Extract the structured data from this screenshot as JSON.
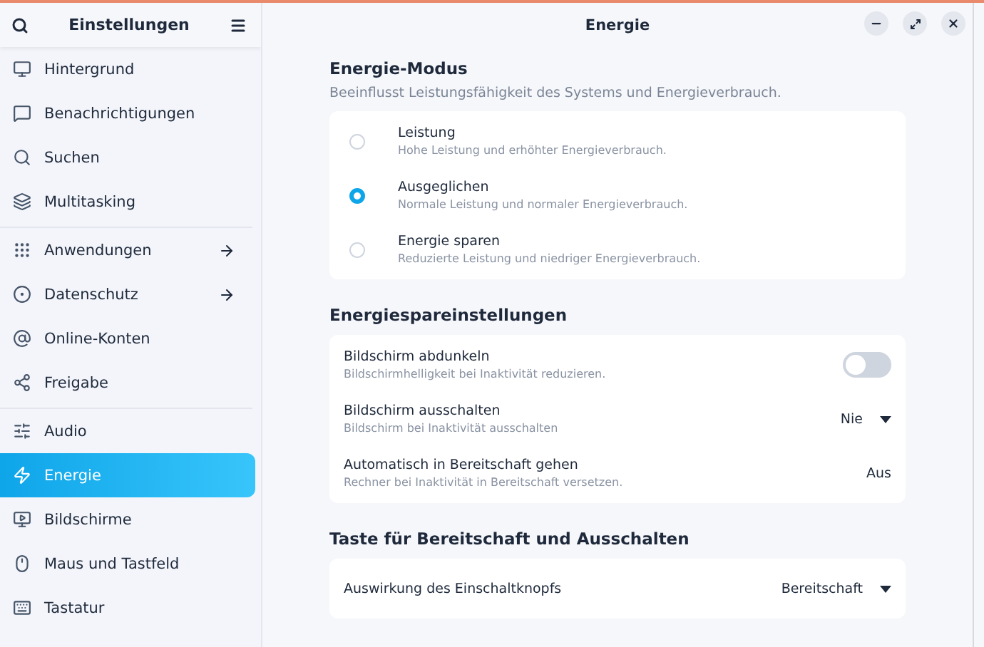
{
  "sidebar": {
    "title": "Einstellungen",
    "groups": [
      {
        "items": [
          {
            "label": "Hintergrund",
            "arrow": false,
            "selected": false
          },
          {
            "label": "Benachrichtigungen",
            "arrow": false,
            "selected": false
          },
          {
            "label": "Suchen",
            "arrow": false,
            "selected": false
          },
          {
            "label": "Multitasking",
            "arrow": false,
            "selected": false
          }
        ]
      },
      {
        "items": [
          {
            "label": "Anwendungen",
            "arrow": true,
            "selected": false
          },
          {
            "label": "Datenschutz",
            "arrow": true,
            "selected": false
          },
          {
            "label": "Online-Konten",
            "arrow": false,
            "selected": false
          },
          {
            "label": "Freigabe",
            "arrow": false,
            "selected": false
          }
        ]
      },
      {
        "items": [
          {
            "label": "Audio",
            "arrow": false,
            "selected": false
          },
          {
            "label": "Energie",
            "arrow": false,
            "selected": true
          },
          {
            "label": "Bildschirme",
            "arrow": false,
            "selected": false
          },
          {
            "label": "Maus und Tastfeld",
            "arrow": false,
            "selected": false
          },
          {
            "label": "Tastatur",
            "arrow": false,
            "selected": false
          }
        ]
      }
    ]
  },
  "window": {
    "title": "Energie"
  },
  "sections": [
    {
      "title": "Energie-Modus",
      "subtitle": "Beeinflusst Leistungsfähigkeit des Systems und Energieverbrauch.",
      "rows": [
        {
          "kind": "radio",
          "label": "Leistung",
          "description": "Hohe Leistung und erhöhter Energieverbrauch.",
          "selected": false
        },
        {
          "kind": "radio",
          "label": "Ausgeglichen",
          "description": "Normale Leistung und normaler Energieverbrauch.",
          "selected": true
        },
        {
          "kind": "radio",
          "label": "Energie sparen",
          "description": "Reduzierte Leistung und niedriger Energieverbrauch.",
          "selected": false
        }
      ]
    },
    {
      "title": "Energiespareinstellungen",
      "rows": [
        {
          "kind": "toggle",
          "label": "Bildschirm abdunkeln",
          "description": "Bildschirmhelligkeit bei Inaktivität reduzieren.",
          "on": false
        },
        {
          "kind": "dropdown",
          "label": "Bildschirm ausschalten",
          "description": "Bildschirm bei Inaktivität ausschalten",
          "value": "Nie"
        },
        {
          "kind": "value",
          "label": "Automatisch in Bereitschaft gehen",
          "description": "Rechner bei Inaktivität in Bereitschaft versetzen.",
          "value": "Aus"
        }
      ]
    },
    {
      "title": "Taste für Bereitschaft und Ausschalten",
      "rows": [
        {
          "kind": "dropdown",
          "label": "Auswirkung des Einschaltknopfs",
          "value": "Bereitschaft"
        }
      ]
    }
  ]
}
